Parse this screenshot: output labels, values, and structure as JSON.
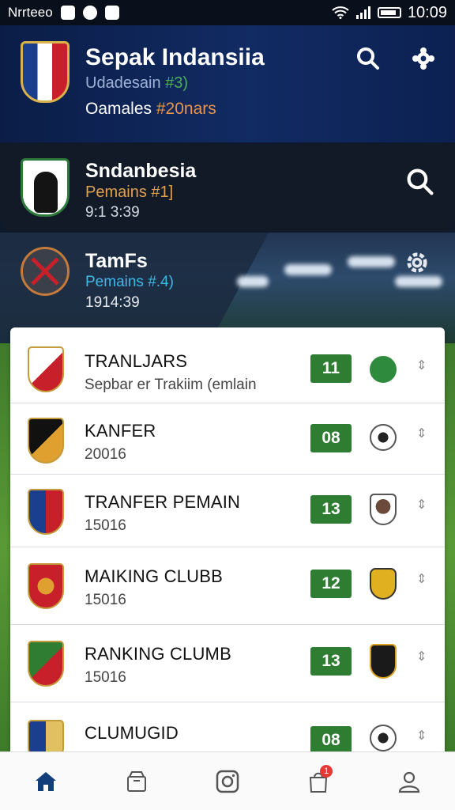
{
  "status_bar": {
    "carrier": "Nrrteeo",
    "time": "10:09"
  },
  "header": {
    "title": "Sepak Indansiia",
    "subtitle_prefix": "Udadesain",
    "subtitle_accent": "#3)",
    "line_prefix": "Oamales",
    "line_accent": "#20nars"
  },
  "card1": {
    "title": "Sndanbesia",
    "subtitle": "Pemains #1]",
    "time": "9:1 3:39"
  },
  "banner": {
    "title": "TamFs",
    "subtitle": "Pemains #.4)",
    "time": "1914:39"
  },
  "list": [
    {
      "title": "TRANLJARS",
      "subtitle": "Sepbar er Trakiim (emlain",
      "score": "11",
      "crest_colors": [
        "#c8202a",
        "#ffffff"
      ],
      "mini_color": "#2e8b3d"
    },
    {
      "title": "KANFER",
      "subtitle": "20016",
      "score": "08",
      "crest_colors": [
        "#111111",
        "#e0a030"
      ],
      "mini_color": "#ffffff"
    },
    {
      "title": "TRANFER PEMAIN",
      "subtitle": "15016",
      "score": "13",
      "crest_colors": [
        "#1b3f8f",
        "#c8202a"
      ],
      "mini_color": "#ffffff"
    },
    {
      "title": "MAIKING CLUBB",
      "subtitle": "15016",
      "score": "12",
      "crest_colors": [
        "#c8202a",
        "#111111"
      ],
      "mini_color": "#e0b020"
    },
    {
      "title": "RANKING CLUMB",
      "subtitle": "15016",
      "score": "13",
      "crest_colors": [
        "#2e7d32",
        "#c8202a"
      ],
      "mini_color": "#d9a020"
    },
    {
      "title": "CLUMUGID",
      "subtitle": "",
      "score": "08",
      "crest_colors": [
        "#1b3f8f",
        "#e0c060"
      ],
      "mini_color": "#ffffff"
    }
  ],
  "bottom_nav": [
    {
      "icon": "home-icon",
      "active": true
    },
    {
      "icon": "box-icon"
    },
    {
      "icon": "camera-icon"
    },
    {
      "icon": "bag-icon",
      "badge": "1"
    },
    {
      "icon": "profile-icon"
    }
  ],
  "colors": {
    "primary": "#112b63",
    "accent_green": "#2e7d32",
    "orange": "#e8954a"
  }
}
